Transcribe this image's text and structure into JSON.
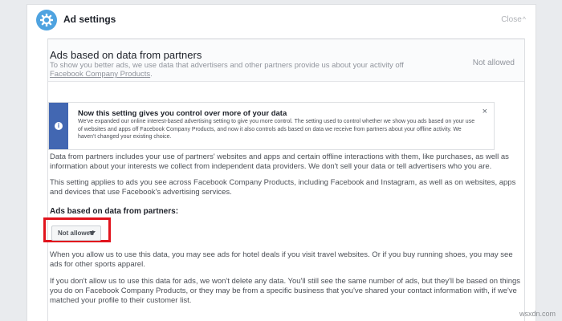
{
  "header": {
    "title": "Ad settings",
    "close_label": "Close",
    "close_caret": "^"
  },
  "section": {
    "title": "Ads based on data from partners",
    "description": "To show you better ads, we use data that advertisers and other partners provide us about your activity off",
    "link_text": "Facebook Company Products",
    "link_suffix": ".",
    "status": "Not allowed"
  },
  "notice": {
    "title": "Now this setting gives you control over more of your data",
    "body": "We've expanded our online interest-based advertising setting to give you more control. The setting used to control whether we show you ads based on your use of websites and apps off Facebook Company Products, and now it also controls ads based on data we receive from partners about your offline activity. We haven't changed your existing choice.",
    "close": "×",
    "icon": "i"
  },
  "body": {
    "para1": "Data from partners includes your use of partners' websites and apps and certain offline interactions with them, like purchases, as well as information about your interests we collect from independent data providers. We don't sell your data or tell advertisers who you are.",
    "para2": "This setting applies to ads you see across Facebook Company Products, including Facebook and Instagram, as well as on websites, apps and devices that use Facebook's advertising services.",
    "sub_label": "Ads based on data from partners:",
    "dropdown_value": "Not allowed",
    "para3": "When you allow us to use this data, you may see ads for hotel deals if you visit travel websites. Or if you buy running shoes, you may see ads for other sports apparel.",
    "para4": "If you don't allow us to use this data for ads, we won't delete any data. You'll still see the same number of ads, but they'll be based on things you do on Facebook Company Products, or they may be from a specific business that you've shared your contact information with, if we've matched your profile to their customer list."
  },
  "watermark": "wsxdn.com",
  "colors": {
    "accent": "#4fa3e0",
    "notice_bar": "#4267b2",
    "highlight": "#e1141d"
  },
  "icons": {
    "settings": "gear-icon",
    "info": "info-icon",
    "dropdown": "caret-down-icon"
  }
}
